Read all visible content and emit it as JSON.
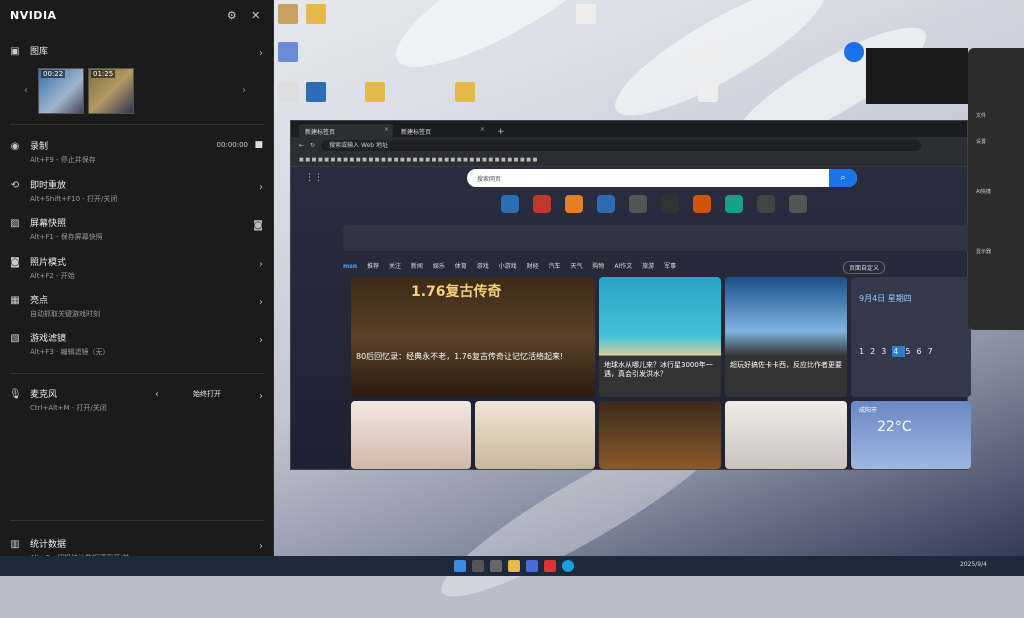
{
  "nvidia": {
    "title": "NVIDIA",
    "gallery": {
      "label": "图库",
      "thumbs": [
        "00:22",
        "01:25"
      ]
    },
    "items": [
      {
        "key": "record",
        "title": "录制",
        "sub": "Alt+F9 - 停止并保存",
        "right": "00:00:00"
      },
      {
        "key": "instant",
        "title": "即时重放",
        "sub": "Alt+Shift+F10 - 打开/关闭"
      },
      {
        "key": "screenshot",
        "title": "屏幕快照",
        "sub": "Alt+F1 - 保存屏幕快照"
      },
      {
        "key": "photo",
        "title": "照片模式",
        "sub": "Alt+F2 - 开始"
      },
      {
        "key": "highlights",
        "title": "亮点",
        "sub": "自动抓取关键游戏时刻"
      },
      {
        "key": "filter",
        "title": "游戏滤镜",
        "sub": "Alt+F3 · 编辑滤镜（无）"
      },
      {
        "key": "mic",
        "title": "麦克风",
        "sub": "Ctrl+Alt+M · 打开/关闭",
        "right": "始终打开"
      },
      {
        "key": "stats",
        "title": "统计数据",
        "sub": "Alt+R - 切换统计数据浮窗开/关"
      }
    ]
  },
  "browser": {
    "tabs": [
      "新建标签页",
      "新建标签页"
    ],
    "url": "搜索或输入 Web 地址",
    "search_placeholder": "搜索网页",
    "msn_tabs": [
      "msn",
      "推荐",
      "关注",
      "新闻",
      "娱乐",
      "体育",
      "游戏",
      "小游戏",
      "财经",
      "汽车",
      "天气",
      "购物",
      "AI作文",
      "旅游",
      "军事"
    ],
    "cards": [
      {
        "title": "80后回忆录：经典永不老，1.76复古传奇让记忆活络起来!",
        "banner": "1.76复古传奇"
      },
      {
        "title": "地球水从哪儿来？冰行星3000年一遇，真会引发洪水？"
      },
      {
        "title": "超玩好搞佐卡卡西，反应比作者更要"
      }
    ],
    "calendar": {
      "date": "9月4日 星期四",
      "days": [
        "1",
        "2",
        "3",
        "4",
        "5",
        "6",
        "7"
      ]
    },
    "weather": {
      "city": "成阳市",
      "temp": "22°C"
    },
    "page_button": "页面自定义"
  },
  "right_panel": {
    "items": [
      "AI快捷",
      "文件",
      "设置",
      "显示器"
    ]
  },
  "taskbar": {
    "time": "2025/9/4"
  }
}
